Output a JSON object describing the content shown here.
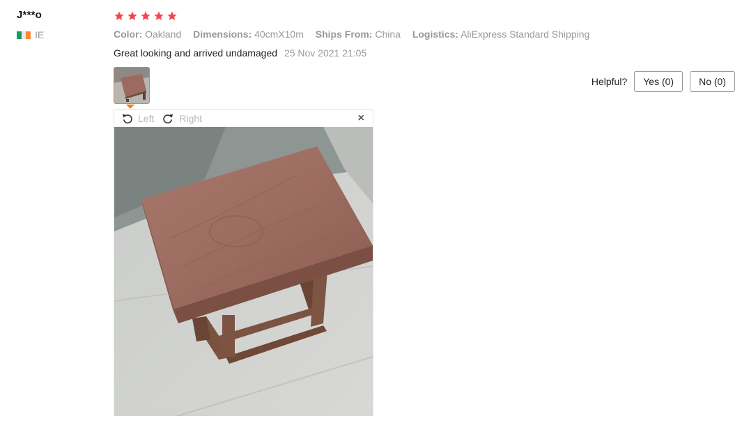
{
  "reviewer": {
    "name": "J***o",
    "country_code": "IE",
    "flag_colors": [
      "#169b62",
      "#ffffff",
      "#ff883e"
    ]
  },
  "rating": {
    "stars": 5,
    "max": 5,
    "color": "#f5464a"
  },
  "attributes": [
    {
      "label": "Color:",
      "value": "Oakland"
    },
    {
      "label": "Dimensions:",
      "value": "40cmX10m"
    },
    {
      "label": "Ships From:",
      "value": "China"
    },
    {
      "label": "Logistics:",
      "value": "AliExpress Standard Shipping"
    }
  ],
  "review": {
    "text": "Great looking and arrived undamaged",
    "date": "25 Nov 2021 21:05"
  },
  "helpful": {
    "label": "Helpful?",
    "yes_label": "Yes (0)",
    "no_label": "No (0)"
  },
  "viewer": {
    "rotate_left_label": "Left",
    "rotate_right_label": "Right",
    "close_glyph": "×"
  },
  "icons": {
    "rotate_left": "rotate-left-icon",
    "rotate_right": "rotate-right-icon",
    "close": "close-icon",
    "star": "star-icon"
  },
  "colors": {
    "accent": "#e6821e"
  }
}
